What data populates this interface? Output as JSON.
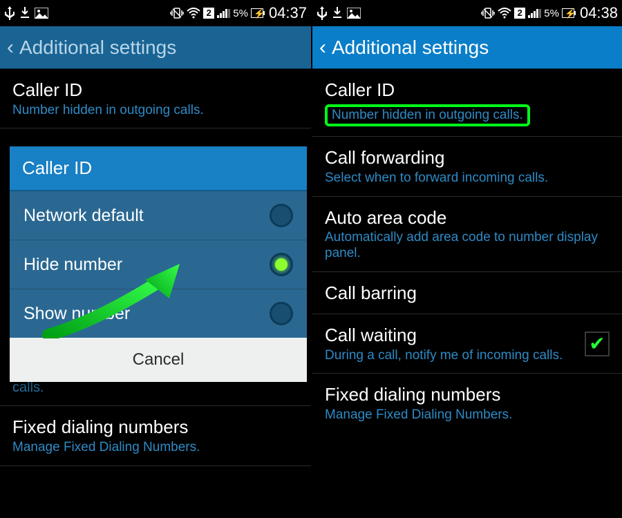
{
  "left": {
    "status": {
      "battery_pct": "5%",
      "time": "04:37",
      "sim_number": "2"
    },
    "header_title": "Additional settings",
    "list": {
      "caller_id": {
        "title": "Caller ID",
        "sub": "Number hidden in outgoing calls."
      },
      "fixed_dialing": {
        "title": "Fixed dialing numbers",
        "sub": "Manage Fixed Dialing Numbers."
      },
      "partial_sub": "calls."
    },
    "dialog": {
      "title": "Caller ID",
      "options": [
        {
          "label": "Network default",
          "selected": false
        },
        {
          "label": "Hide number",
          "selected": true
        },
        {
          "label": "Show number",
          "selected": false
        }
      ],
      "cancel_label": "Cancel"
    }
  },
  "right": {
    "status": {
      "battery_pct": "5%",
      "time": "04:38",
      "sim_number": "2"
    },
    "header_title": "Additional settings",
    "rows": {
      "caller_id": {
        "title": "Caller ID",
        "sub": "Number hidden in outgoing calls."
      },
      "call_fwd": {
        "title": "Call forwarding",
        "sub": "Select when to forward incoming calls."
      },
      "auto_area": {
        "title": "Auto area code",
        "sub": "Automatically add area code to number display panel."
      },
      "call_barring": {
        "title": "Call barring",
        "sub": ""
      },
      "call_waiting": {
        "title": "Call waiting",
        "sub": "During a call, notify me of incoming calls.",
        "checked": true
      },
      "fixed_dialing": {
        "title": "Fixed dialing numbers",
        "sub": "Manage Fixed Dialing Numbers."
      }
    }
  }
}
